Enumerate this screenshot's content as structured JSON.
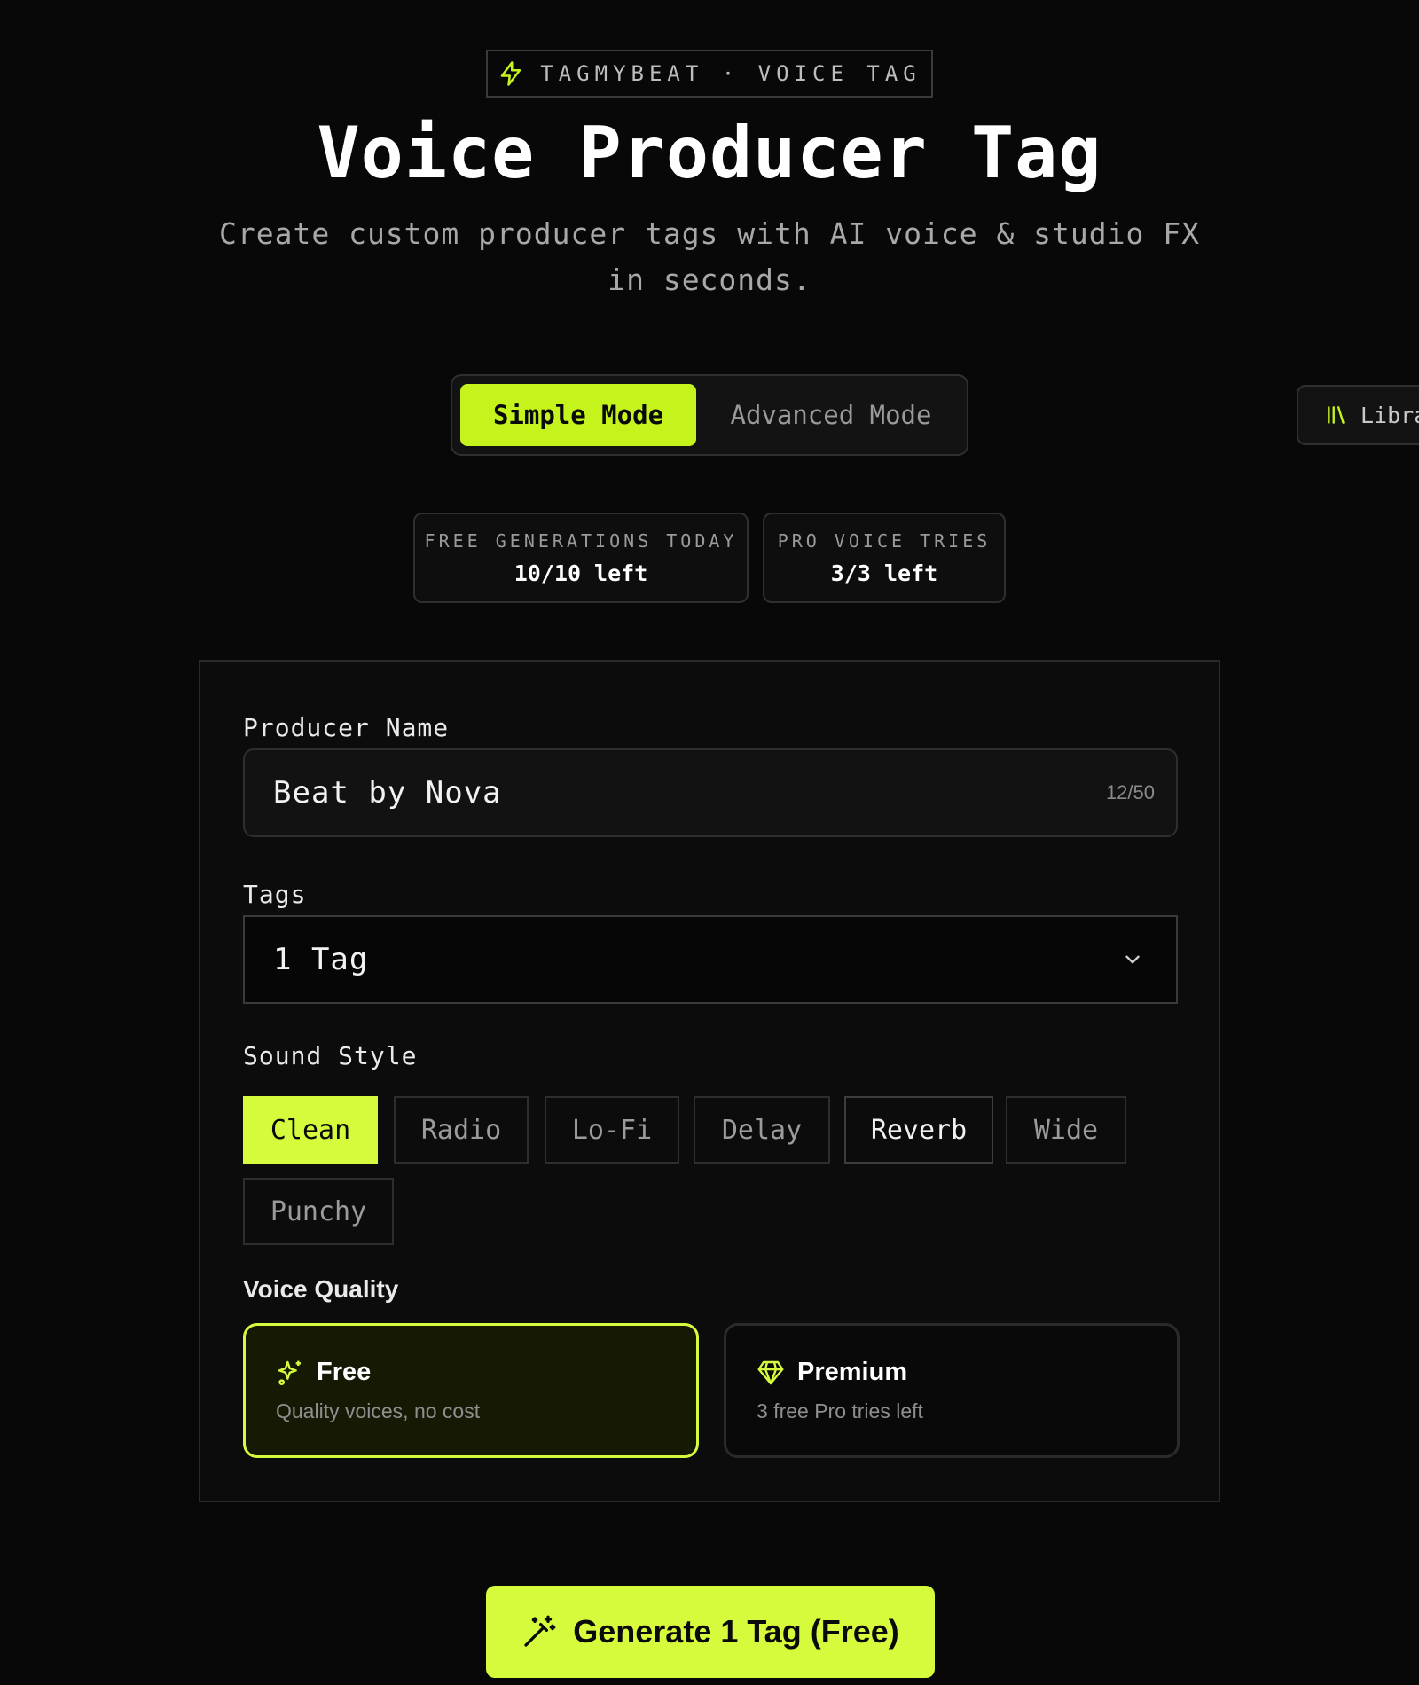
{
  "header": {
    "badge_icon": "lightning-icon",
    "badge_text": "TAGMYBEAT · VOICE TAG",
    "title": "Voice Producer Tag",
    "subtitle": "Create custom producer tags with AI voice & studio FX in seconds."
  },
  "mode_toggle": {
    "simple_label": "Simple Mode",
    "advanced_label": "Advanced Mode",
    "active": "Simple Mode"
  },
  "library": {
    "icon": "library-icon",
    "label": "Libra"
  },
  "stats": {
    "free": {
      "label": "FREE GENERATIONS TODAY",
      "value": "10/10 left"
    },
    "pro": {
      "label": "PRO VOICE TRIES",
      "value": "3/3 left"
    }
  },
  "form": {
    "producer_name": {
      "label": "Producer Name",
      "value": "Beat by Nova",
      "counter": "12/50"
    },
    "tags": {
      "label": "Tags",
      "value": "1 Tag",
      "icon": "chevron-down-icon"
    },
    "sound_style": {
      "label": "Sound Style",
      "options": [
        "Clean",
        "Radio",
        "Lo-Fi",
        "Delay",
        "Reverb",
        "Wide",
        "Punchy"
      ],
      "selected": "Clean"
    },
    "voice_quality": {
      "label": "Voice Quality",
      "free": {
        "icon": "sparkles-icon",
        "title": "Free",
        "description": "Quality voices, no cost"
      },
      "premium": {
        "icon": "diamond-icon",
        "title": "Premium",
        "description": "3 free Pro tries left"
      },
      "selected": "Free"
    }
  },
  "generate": {
    "icon": "magic-wand-icon",
    "label": "Generate 1 Tag (Free)"
  },
  "colors": {
    "accent": "#d6fb3d",
    "accent_alt": "#c5f41c",
    "background": "#080808"
  }
}
